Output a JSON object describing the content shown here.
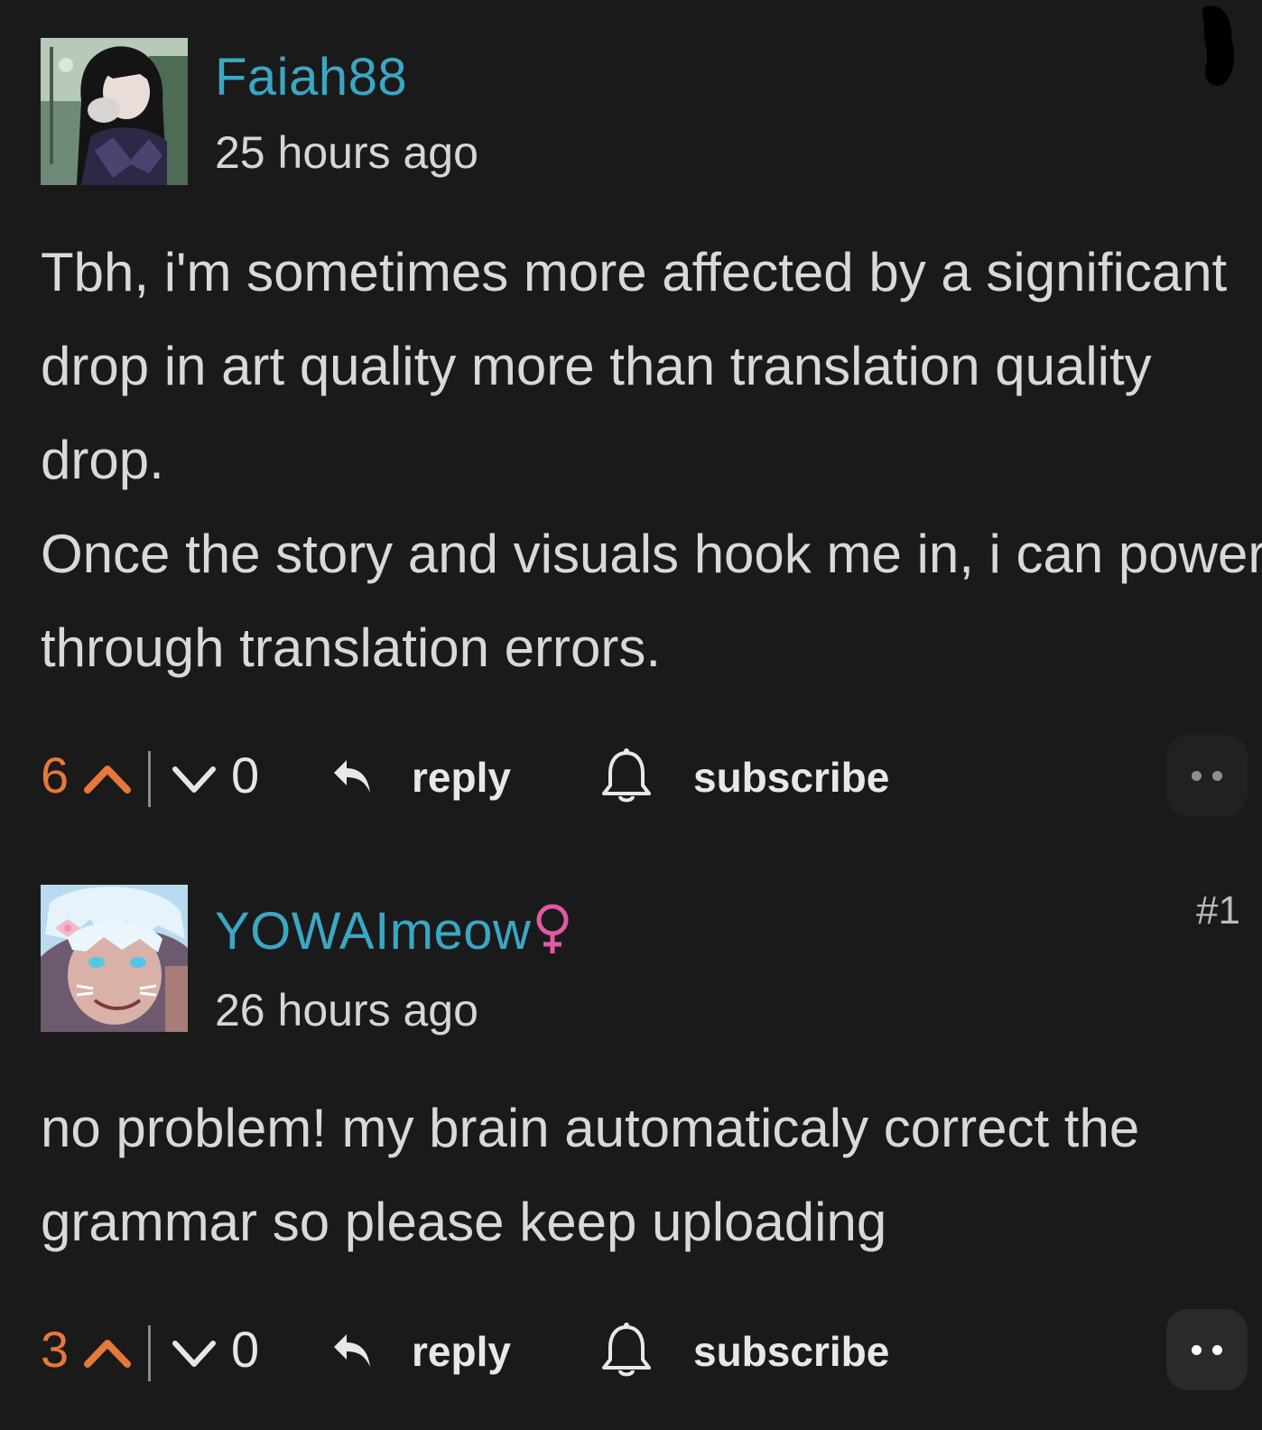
{
  "comments": [
    {
      "username": "Faiah88",
      "timestamp": "25 hours ago",
      "lines": [
        "Tbh, i'm sometimes more affected by a significant",
        "drop in art quality more than translation quality",
        "drop.",
        "Once the story and visuals hook me in, i can power",
        "through translation errors."
      ],
      "upvotes": "6",
      "downvotes": "0",
      "reply_label": "reply",
      "subscribe_label": "subscribe",
      "icons": [
        "avatar-image",
        "upvote-chevron-icon",
        "downvote-chevron-icon",
        "reply-arrow-icon",
        "bell-icon",
        "more-dots-icon"
      ]
    },
    {
      "username": "YOWAImeow",
      "gender_symbol": "female-symbol-icon",
      "timestamp": "26 hours ago",
      "comment_number": "#1",
      "lines": [
        "no problem! my brain automaticaly correct the",
        "grammar so please keep uploading"
      ],
      "upvotes": "3",
      "downvotes": "0",
      "reply_label": "reply",
      "subscribe_label": "subscribe",
      "icons": [
        "avatar-image",
        "upvote-chevron-icon",
        "downvote-chevron-icon",
        "reply-arrow-icon",
        "bell-icon",
        "more-dots-icon"
      ]
    }
  ],
  "colors": {
    "background": "#1a1a1b",
    "username": "#3aa7c4",
    "upvote": "#e6783a",
    "gender_symbol": "#e05aa6",
    "text": "#d9d9d9"
  }
}
